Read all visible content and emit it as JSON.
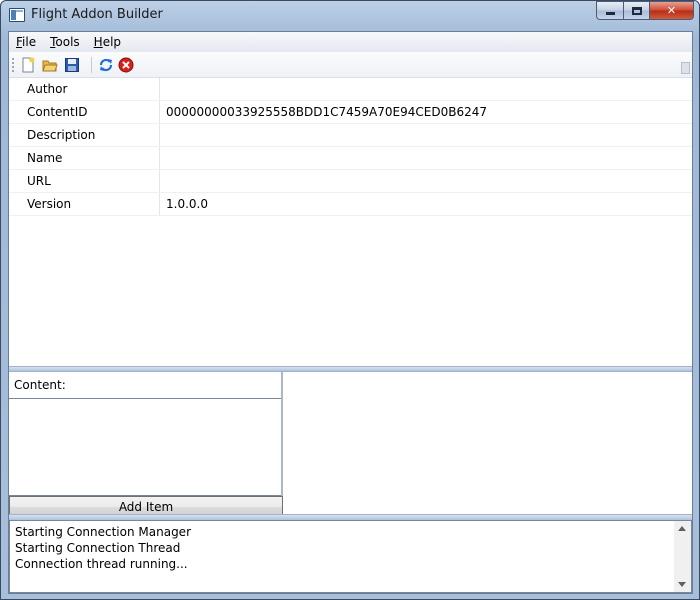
{
  "window": {
    "title": "Flight Addon Builder"
  },
  "menu": [
    {
      "label": "File",
      "accel": "F",
      "rest": "ile"
    },
    {
      "label": "Tools",
      "accel": "T",
      "rest": "ools"
    },
    {
      "label": "Help",
      "accel": "H",
      "rest": "elp"
    }
  ],
  "toolbar": {
    "icons": [
      "new-file-icon",
      "open-folder-icon",
      "save-icon",
      "refresh-icon",
      "stop-icon"
    ]
  },
  "properties": [
    {
      "name": "Author",
      "value": ""
    },
    {
      "name": "ContentID",
      "value": "00000000033925558BDD1C7459A70E94CED0B6247"
    },
    {
      "name": "Description",
      "value": ""
    },
    {
      "name": "Name",
      "value": ""
    },
    {
      "name": "URL",
      "value": ""
    },
    {
      "name": "Version",
      "value": "1.0.0.0"
    }
  ],
  "content": {
    "label": "Content:",
    "add_item_label": "Add Item"
  },
  "log": {
    "lines": [
      "Starting Connection Manager",
      "Starting Connection Thread",
      "Connection thread running..."
    ]
  },
  "colors": {
    "title_gradient": "#bcd0e6",
    "close_button": "#cf4a34",
    "splitter": "#aec2dc"
  }
}
